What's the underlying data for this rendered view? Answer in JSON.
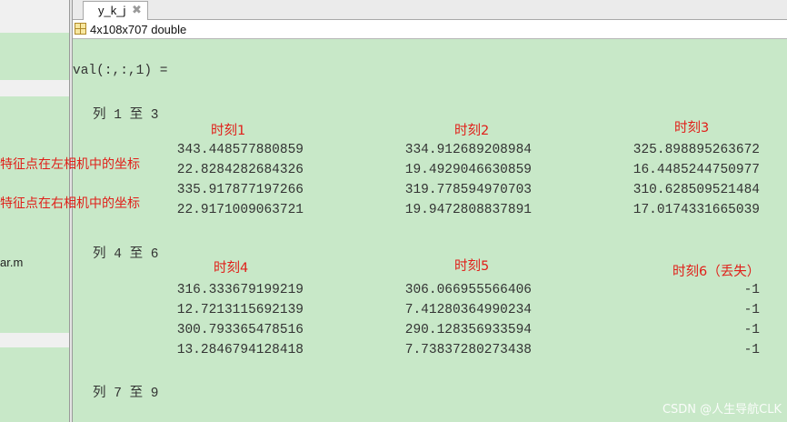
{
  "left_panel": {
    "file_fragment": "ar.m"
  },
  "tab": {
    "title": "y_k_j",
    "close_glyph": "✖"
  },
  "variable_info": "4x108x707 double",
  "output": {
    "header": "val(:,:,1) =",
    "blocks": [
      {
        "label": "列 1 至 3",
        "time_labels": [
          "时刻1",
          "时刻2",
          "时刻3"
        ],
        "rows": [
          [
            "343.448577880859",
            "334.912689208984",
            "325.898895263672"
          ],
          [
            "22.8284282684326",
            "19.4929046630859",
            "16.4485244750977"
          ],
          [
            "335.917877197266",
            "319.778594970703",
            "310.628509521484"
          ],
          [
            "22.9171009063721",
            "19.9472808837891",
            "17.0174331665039"
          ]
        ]
      },
      {
        "label": "列 4 至 6",
        "time_labels": [
          "时刻4",
          "时刻5",
          "时刻6（丢失）"
        ],
        "rows": [
          [
            "316.333679199219",
            "306.066955566406",
            "-1"
          ],
          [
            "12.7213115692139",
            "7.41280364990234",
            "-1"
          ],
          [
            "300.793365478516",
            "290.128356933594",
            "-1"
          ],
          [
            "13.2846794128418",
            "7.73837280273438",
            "-1"
          ]
        ]
      },
      {
        "label": "列 7 至 9"
      }
    ]
  },
  "annotations": {
    "left_camera": "特征点在左相机中的坐标",
    "right_camera": "特征点在右相机中的坐标"
  },
  "watermark": "CSDN @人生导航CLK",
  "colors": {
    "content_bg": "#c8e8c8",
    "annotation_red": "#e0201a"
  },
  "icons": {
    "variable_icon": "grid-icon"
  }
}
